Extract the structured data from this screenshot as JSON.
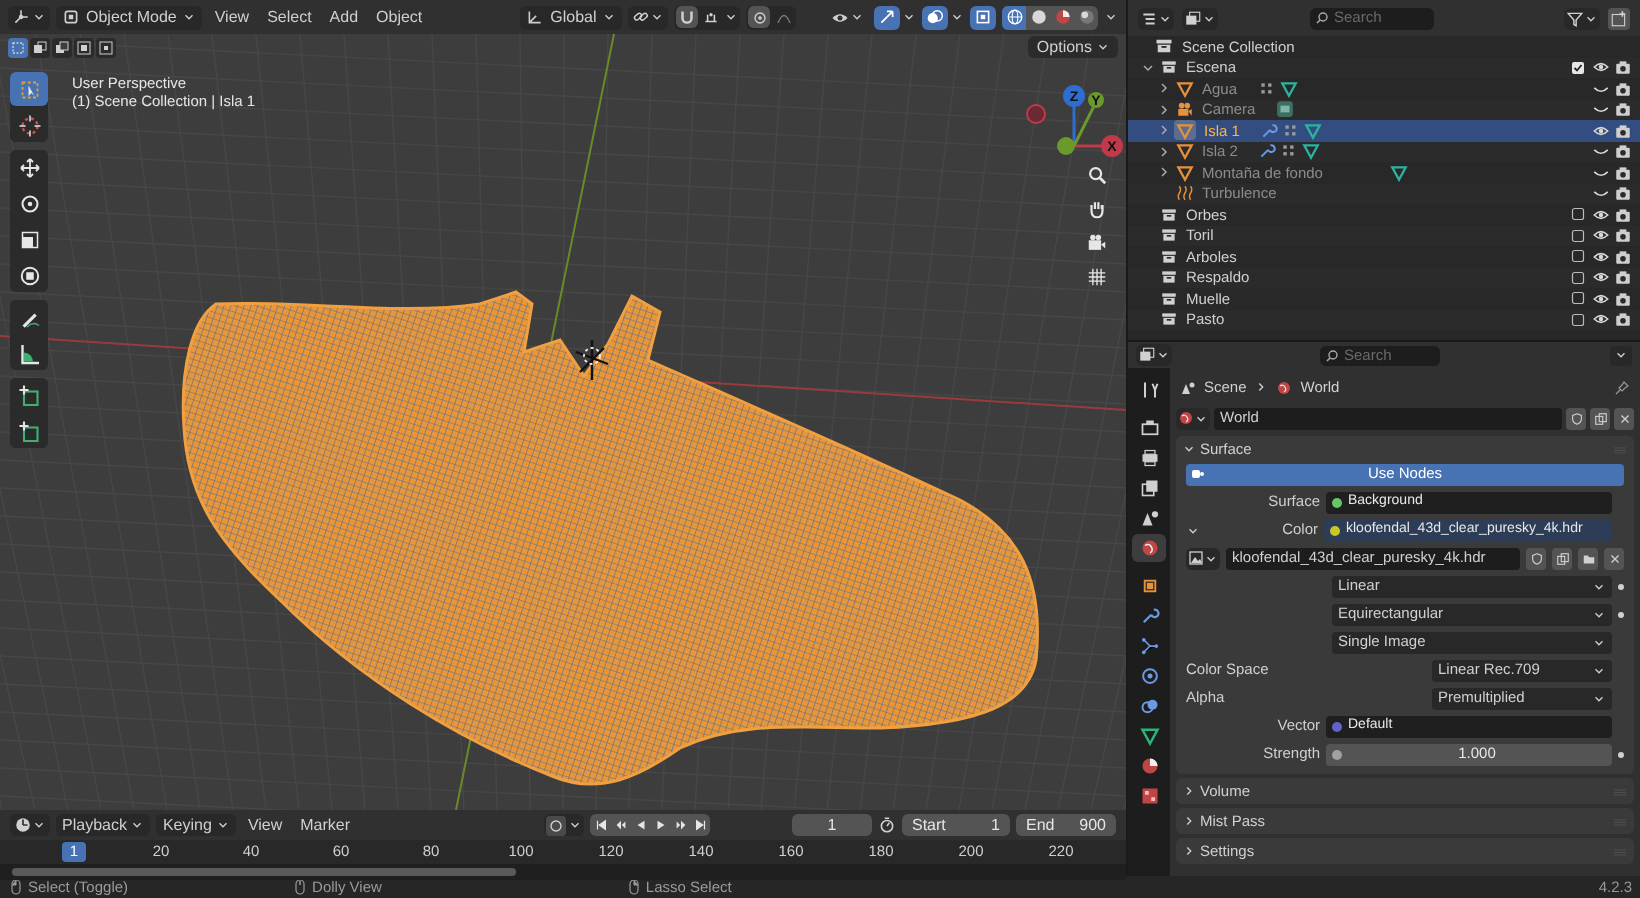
{
  "viewport_header": {
    "mode": "Object Mode",
    "menus": [
      "View",
      "Select",
      "Add",
      "Object"
    ],
    "orientation": "Global",
    "shading": [
      {
        "kind": "wireframe",
        "selected": true
      },
      {
        "kind": "solid",
        "selected": false
      },
      {
        "kind": "material",
        "selected": false
      },
      {
        "kind": "rendered",
        "selected": false
      }
    ]
  },
  "viewport": {
    "options": "Options",
    "view_name": "User Perspective",
    "context": "(1) Scene Collection | Isla 1",
    "tools": [
      [
        {
          "kind": "select-box",
          "selected": true
        },
        {
          "kind": "cursor",
          "selected": false
        }
      ],
      [
        {
          "kind": "move",
          "selected": false
        },
        {
          "kind": "rotate",
          "selected": false
        },
        {
          "kind": "scale",
          "selected": false
        },
        {
          "kind": "transform",
          "selected": false
        }
      ],
      [
        {
          "kind": "annotate",
          "selected": false
        },
        {
          "kind": "measure",
          "selected": false
        }
      ],
      [
        {
          "kind": "add-cube",
          "selected": false
        },
        {
          "kind": "add-cube",
          "selected": false
        }
      ]
    ],
    "gizmo": {
      "z": "Z",
      "y": "Y",
      "x": "X"
    }
  },
  "timeline": {
    "menus": [
      "Playback",
      "Keying",
      "View",
      "Marker"
    ],
    "current_frame": "1",
    "start_label": "Start",
    "start": "1",
    "end_label": "End",
    "end": "900",
    "playhead": "1",
    "ruler": [
      "20",
      "40",
      "60",
      "80",
      "100",
      "120",
      "140",
      "160",
      "180",
      "200",
      "220"
    ]
  },
  "outliner": {
    "search": {
      "placeholder": "Search"
    },
    "items": [
      {
        "name": "Scene Collection",
        "kind": "root",
        "children": [
          {
            "name": "Escena",
            "kind": "collection",
            "expanded": true,
            "checked": true,
            "visible": true,
            "selected": false,
            "children": [
              {
                "name": "Agua",
                "kind": "mesh",
                "expanded": false,
                "visible": false,
                "selected": false,
                "modifiers": false,
                "particles": true
              },
              {
                "name": "Camera",
                "kind": "camera",
                "expanded": false,
                "visible": false,
                "selected": false
              },
              {
                "name": "Isla 1",
                "kind": "mesh",
                "expanded": false,
                "visible": true,
                "selected": true,
                "modifiers": true,
                "particles": true
              },
              {
                "name": "Isla 2",
                "kind": "mesh",
                "expanded": false,
                "visible": false,
                "selected": false,
                "modifiers": true,
                "particles": true
              },
              {
                "name": "Montaña de fondo",
                "kind": "mesh",
                "expanded": false,
                "visible": false,
                "selected": false,
                "modifiers": false,
                "particles": false
              },
              {
                "name": "Turbulence",
                "kind": "force",
                "visible": false,
                "selected": false
              }
            ]
          },
          {
            "name": "Orbes",
            "kind": "collection",
            "checked": false,
            "visible": true,
            "selected": false
          },
          {
            "name": "Toril",
            "kind": "collection",
            "checked": false,
            "visible": true,
            "selected": false
          },
          {
            "name": "Arboles",
            "kind": "collection",
            "checked": false,
            "visible": true,
            "selected": false
          },
          {
            "name": "Respaldo",
            "kind": "collection",
            "checked": false,
            "visible": true,
            "selected": false
          },
          {
            "name": "Muelle",
            "kind": "collection",
            "checked": false,
            "visible": true,
            "selected": false
          },
          {
            "name": "Pasto",
            "kind": "collection",
            "checked": false,
            "visible": true,
            "selected": false
          }
        ]
      }
    ]
  },
  "properties": {
    "search": {
      "placeholder": "Search"
    },
    "tabs": [
      {
        "kind": "tool",
        "selected": false
      },
      {
        "kind": "render",
        "selected": false
      },
      {
        "kind": "output",
        "selected": false
      },
      {
        "kind": "view-layer",
        "selected": false
      },
      {
        "kind": "scene",
        "selected": false
      },
      {
        "kind": "world",
        "selected": true
      },
      {
        "kind": "object",
        "selected": false
      },
      {
        "kind": "modifier",
        "selected": false
      },
      {
        "kind": "particles",
        "selected": false
      },
      {
        "kind": "physics",
        "selected": false
      },
      {
        "kind": "constraints",
        "selected": false
      },
      {
        "kind": "data",
        "selected": false
      },
      {
        "kind": "material",
        "selected": false
      },
      {
        "kind": "texture",
        "selected": false
      }
    ],
    "breadcrumb": [
      "Scene",
      "World"
    ],
    "datablock": "World",
    "panels": [
      {
        "title": "Surface",
        "expanded": true,
        "rows": [
          {
            "kind": "button",
            "label": "Use Nodes"
          },
          {
            "kind": "socket",
            "label": "Surface",
            "value": "Background",
            "color": "#63c763"
          },
          {
            "kind": "socket",
            "label": "Color",
            "value": "kloofendal_43d_clear_puresky_4k.hdr",
            "color": "#c7c729",
            "expanded": true
          },
          {
            "kind": "image",
            "value": "kloofendal_43d_clear_puresky_4k.hdr"
          },
          {
            "kind": "dropdown",
            "value": "Linear",
            "keyframe": true
          },
          {
            "kind": "dropdown",
            "value": "Equirectangular",
            "keyframe": true
          },
          {
            "kind": "dropdown",
            "value": "Single Image",
            "keyframe": false
          },
          {
            "kind": "labeled-dropdown",
            "label": "Color Space",
            "value": "Linear Rec.709"
          },
          {
            "kind": "labeled-dropdown",
            "label": "Alpha",
            "value": "Premultiplied"
          },
          {
            "kind": "socket",
            "label": "Vector",
            "value": "Default",
            "color": "#6363c7"
          },
          {
            "kind": "number",
            "label": "Strength",
            "value": "1.000",
            "color": "#a1a1a1",
            "keyframe": true
          }
        ]
      },
      {
        "title": "Volume",
        "expanded": false
      },
      {
        "title": "Mist Pass",
        "expanded": false
      },
      {
        "title": "Settings",
        "expanded": false
      }
    ]
  },
  "status_bar": {
    "hints": [
      "Select (Toggle)",
      "Dolly View",
      "Lasso Select"
    ],
    "version": "4.2.3"
  }
}
